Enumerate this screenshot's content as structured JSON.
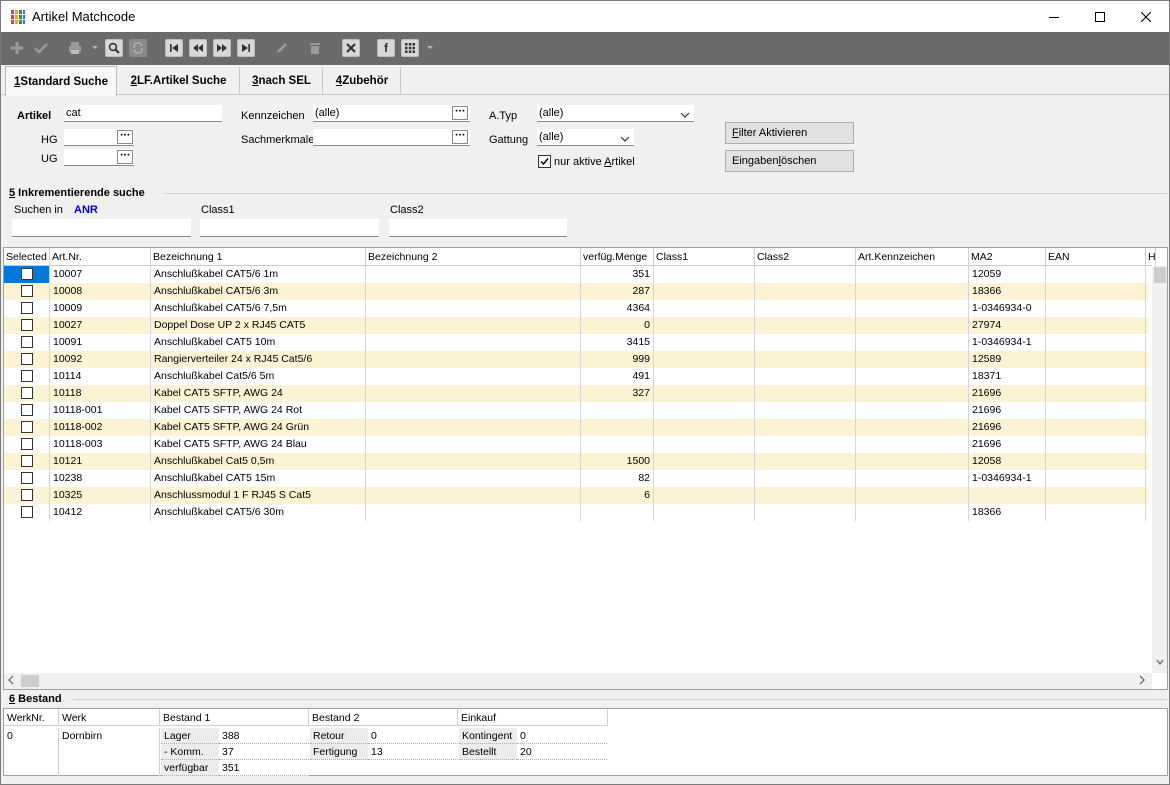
{
  "window": {
    "title": "Artikel Matchcode",
    "icon": "grid-app-icon"
  },
  "titlebar": {
    "minimize": "—",
    "maximize": "☐",
    "close": "✕"
  },
  "toolbar": {
    "items": [
      "add-icon",
      "check-icon",
      "print-icon",
      "search-icon",
      "refresh-icon",
      "first-icon",
      "prev-icon",
      "next-icon",
      "last-icon",
      "edit-icon",
      "delete-icon",
      "cancel-icon",
      "facebook-icon",
      "grid-menu-icon"
    ],
    "facebook_label": "f"
  },
  "tabs": [
    {
      "key": "1",
      "label": " Standard Suche"
    },
    {
      "key": "2",
      "label": " LF.Artikel Suche"
    },
    {
      "key": "3",
      "label": " nach SEL"
    },
    {
      "key": "4",
      "label": " Zubehör"
    }
  ],
  "filters": {
    "artikel_label": "Artikel",
    "artikel_value": "cat",
    "hg_label": "HG",
    "ug_label": "UG",
    "kennzeichen_label": "Kennzeichen",
    "kennzeichen_value": "(alle)",
    "sachmerkmale_label": "Sachmerkmale",
    "atyp_label": "A.Typ",
    "atyp_value": "(alle)",
    "gattung_label": "Gattung",
    "gattung_value": "(alle)",
    "nur_aktive_pre": "nur aktive ",
    "nur_aktive_ul": "A",
    "nur_aktive_post": "rtikel",
    "nur_aktive_checked": true,
    "filter_btn_ul": "F",
    "filter_btn_rest": "ilter Aktivieren",
    "clear_btn_pre": "Eingaben ",
    "clear_btn_ul": "l",
    "clear_btn_post": "öschen",
    "dots": "···"
  },
  "inkrement": {
    "section_key": "5",
    "section_label": " Inkrementierende suche",
    "suchen_in_label": "Suchen in",
    "suchen_in_value": "ANR",
    "class1_label": "Class1",
    "class2_label": "Class2"
  },
  "grid": {
    "columns": [
      "Selected",
      "Art.Nr.",
      "Bezeichnung 1",
      "Bezeichnung 2",
      "verfüg.Menge",
      "Class1",
      "Class2",
      "Art.Kennzeichen",
      "MA2",
      "EAN",
      "H"
    ],
    "rows": [
      {
        "artnr": "10007",
        "bez1": "Anschlußkabel CAT5/6 1m",
        "menge": "351",
        "ma2": "12059"
      },
      {
        "artnr": "10008",
        "bez1": "Anschlußkabel CAT5/6 3m",
        "menge": "287",
        "ma2": "18366"
      },
      {
        "artnr": "10009",
        "bez1": "Anschlußkabel CAT5/6 7,5m",
        "menge": "4364",
        "ma2": "1-0346934-0"
      },
      {
        "artnr": "10027",
        "bez1": "Doppel Dose UP 2 x RJ45 CAT5",
        "menge": "0",
        "ma2": "27974"
      },
      {
        "artnr": "10091",
        "bez1": "Anschlußkabel CAT5 10m",
        "menge": "3415",
        "ma2": "1-0346934-1"
      },
      {
        "artnr": "10092",
        "bez1": "Rangierverteiler 24 x RJ45 Cat5/6",
        "menge": "999",
        "ma2": "12589"
      },
      {
        "artnr": "10114",
        "bez1": "Anschlußkabel Cat5/6 5m",
        "menge": "491",
        "ma2": "18371"
      },
      {
        "artnr": "10118",
        "bez1": "Kabel CAT5 SFTP, AWG 24",
        "menge": "327",
        "ma2": "21696"
      },
      {
        "artnr": "10118-001",
        "bez1": "Kabel CAT5 SFTP, AWG 24 Rot",
        "menge": "",
        "ma2": "21696"
      },
      {
        "artnr": "10118-002",
        "bez1": "Kabel CAT5 SFTP, AWG 24 Grün",
        "menge": "",
        "ma2": "21696"
      },
      {
        "artnr": "10118-003",
        "bez1": "Kabel CAT5 SFTP, AWG 24 Blau",
        "menge": "",
        "ma2": "21696"
      },
      {
        "artnr": "10121",
        "bez1": "Anschlußkabel Cat5 0,5m",
        "menge": "1500",
        "ma2": "12058"
      },
      {
        "artnr": "10238",
        "bez1": "Anschlußkabel CAT5 15m",
        "menge": "82",
        "ma2": "1-0346934-1"
      },
      {
        "artnr": "10325",
        "bez1": "Anschlussmodul 1 F RJ45 S Cat5",
        "menge": "6",
        "ma2": ""
      },
      {
        "artnr": "10412",
        "bez1": "Anschlußkabel CAT5/6 30m",
        "menge": "",
        "ma2": "18366"
      }
    ]
  },
  "bestand": {
    "section_key": "6",
    "section_label": " Bestand",
    "headers": [
      "WerkNr.",
      "Werk",
      "Bestand 1",
      "Bestand 2",
      "Einkauf"
    ],
    "werknr": "0",
    "werk": "Dornbirn",
    "b1": [
      {
        "k": "Lager",
        "v": "388"
      },
      {
        "k": "- Komm.",
        "v": "37"
      },
      {
        "k": "verfügbar",
        "v": "351"
      }
    ],
    "b2": [
      {
        "k": "Retour",
        "v": "0"
      },
      {
        "k": "Fertigung",
        "v": "13"
      }
    ],
    "ek": [
      {
        "k": "Kontingent",
        "v": "0"
      },
      {
        "k": "Bestellt",
        "v": "20"
      }
    ]
  },
  "colors": {
    "accent": "#0078d7",
    "toolbar": "#6b6b6b",
    "row_alt": "#fcf3d4",
    "link_blue": "#0000c8"
  }
}
